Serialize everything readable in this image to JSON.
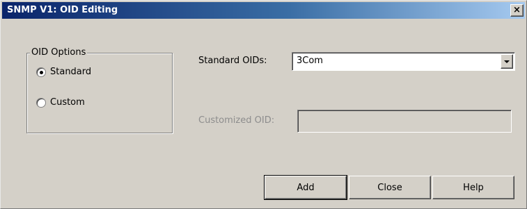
{
  "window": {
    "title": "SNMP V1: OID Editing",
    "close_label": "×"
  },
  "oid_options": {
    "legend": "OID Options",
    "standard_label": "Standard",
    "custom_label": "Custom",
    "selected": "Standard"
  },
  "standard_oids": {
    "label": "Standard OIDs:",
    "value": "3Com"
  },
  "customized_oid": {
    "label": "Customized OID:",
    "value": ""
  },
  "buttons": {
    "add": "Add",
    "close": "Close",
    "help": "Help"
  }
}
